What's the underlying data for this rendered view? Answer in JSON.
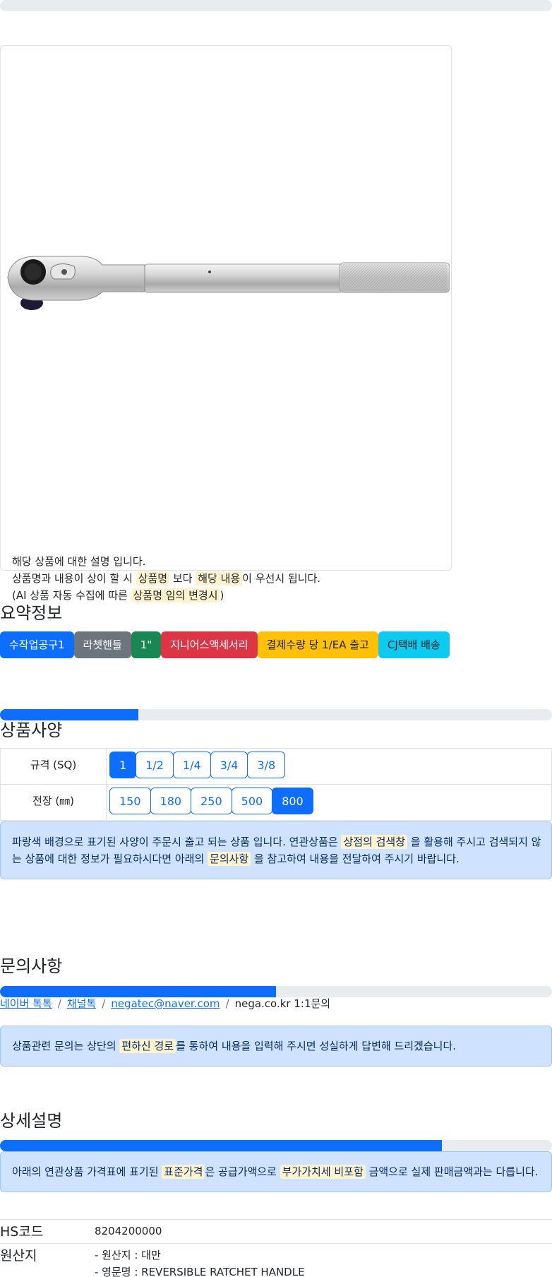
{
  "product_card": {
    "image_alt": "ratchet-handle-photo",
    "desc_line1": "해당 상품에 대한 설명 입니다.",
    "desc_line2_a": "상품명과 내용이 상이 할 시 ",
    "desc_line2_hl1": "상품명",
    "desc_line2_b": " 보다 ",
    "desc_line2_hl2": "해당 내용",
    "desc_line2_c": "이 우선시 됩니다.",
    "desc_line3_a": "(AI 상품 자동 수집에 따른 ",
    "desc_line3_hl": "상품명 임의 변경시",
    "desc_line3_b": ")"
  },
  "summary": {
    "title": "요약정보",
    "badges": [
      "수작업공구1",
      "라쳇핸들",
      "1\"",
      "지니어스액세서리",
      "결제수량 당 1/EA 출고",
      "CJ택배 배송"
    ]
  },
  "spec": {
    "title": "상품사양",
    "progress": 0.25,
    "rows": [
      {
        "label": "규격 (SQ)",
        "options": [
          "1",
          "1/2",
          "1/4",
          "3/4",
          "3/8"
        ],
        "selected": "1"
      },
      {
        "label": "전장 (㎜)",
        "options": [
          "150",
          "180",
          "250",
          "500",
          "800"
        ],
        "selected": "800"
      }
    ],
    "notice_a": "파랑색 배경으로 표기된 사양이 주문시 출고 되는 상품 입니다. 연관상품은 ",
    "notice_hl1": "상점의 검색창",
    "notice_b": " 을 활용해 주시고 검색되지 않",
    "notice_c": "는 상품에 대한 정보가 필요하시다면 아래의 ",
    "notice_hl2": "문의사항",
    "notice_d": " 을 참고하여 내용을 전달하여 주시기 바랍니다."
  },
  "inquiry": {
    "title": "문의사항",
    "progress": 0.5,
    "links": [
      "네이버 톡톡",
      "채널톡",
      "negatec@naver.com"
    ],
    "plain": "nega.co.kr 1:1문의",
    "notice_a": "상품관련 문의는 상단의 ",
    "notice_hl": "편하신 경로",
    "notice_b": "를 통하여 내용을 입력해 주시면 성실하게 답변해 드리겠습니다."
  },
  "detail": {
    "title": "상세설명",
    "progress": 0.8,
    "notice_a": "아래의 연관상품 가격표에 표기된 ",
    "notice_hl1": "표준가격",
    "notice_b": "은 공급가액으로 ",
    "notice_hl2": "부가가치세 비포함",
    "notice_c": " 금액으로 실제 판매금액과는 다릅니다.",
    "hs_label": "HS코드",
    "hs_value": "8204200000",
    "origin_label": "원산지",
    "origin_line1": "- 원산지 : 대만",
    "origin_line2": "- 영문명 : REVERSIBLE RATCHET HANDLE"
  },
  "colors": {
    "primary": "#0d6efd",
    "highlight": "#fff3cd",
    "alert_bg": "#cfe2ff"
  }
}
